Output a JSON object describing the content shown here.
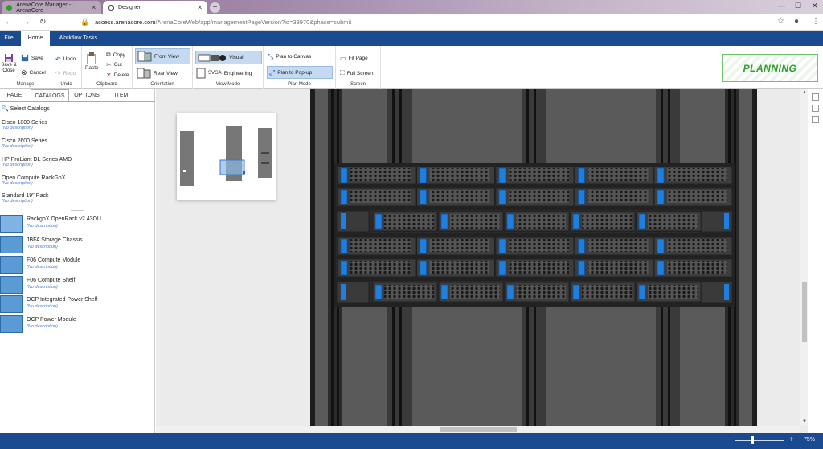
{
  "browser": {
    "tabs": [
      {
        "label": "ArenaCore Manager - ArenaCore",
        "active": false
      },
      {
        "label": "Designer",
        "active": true
      }
    ],
    "url_domain": "access.arenacore.com",
    "url_path": "/ArenaCoreWeb/app/managementPageVersion?id=33970&phase=submit"
  },
  "menu": {
    "items": [
      "File",
      "Home",
      "Workflow Tasks"
    ],
    "active": "Home"
  },
  "ribbon": {
    "manage": {
      "save_close": "Save &\nClose",
      "save": "Save",
      "cancel": "Cancel",
      "label": "Manage"
    },
    "undo": {
      "undo": "Undo",
      "redo": "Redo",
      "label": "Undo"
    },
    "clipboard": {
      "paste": "Paste",
      "copy": "Copy",
      "cut": "Cut",
      "delete": "Delete",
      "label": "Clipboard"
    },
    "orientation": {
      "front": "Front View",
      "rear": "Rear View",
      "label": "Orientation"
    },
    "viewmode": {
      "visual": "Visual",
      "engineering": "Engineering",
      "svga": "SVGA",
      "label": "View Mode"
    },
    "planmode": {
      "canvas": "Plan to Canvas",
      "popup": "Plan to Pop-up",
      "label": "Plan Mode"
    },
    "screen": {
      "fit": "Fit Page",
      "full": "Full Screen",
      "label": "Screen"
    },
    "status": "PLANNING"
  },
  "leftpanel": {
    "tabs": [
      "PAGE",
      "CATALOGS",
      "OPTIONS",
      "ITEM"
    ],
    "active_tab": "CATALOGS",
    "select_label": "Select Catalogs",
    "catalogs": [
      {
        "title": "Cisco 1800 Series",
        "desc": "(No description)"
      },
      {
        "title": "Cisco 2600 Series",
        "desc": "(No description)"
      },
      {
        "title": "HP ProLiant DL Series AMD",
        "desc": "(No description)"
      },
      {
        "title": "Open Compute RackGoX",
        "desc": "(No description)"
      },
      {
        "title": "Standard 19\" Rack",
        "desc": "(No description)"
      }
    ],
    "components": [
      {
        "title": "RackgoX OpenRack v2 43OU",
        "desc": "(No description)"
      },
      {
        "title": "JBFA Storage Chassis",
        "desc": "(No description)"
      },
      {
        "title": "F06 Compute Module",
        "desc": "(No description)"
      },
      {
        "title": "F06 Compute Shelf",
        "desc": "(No description)"
      },
      {
        "title": "OCP Integrated Power Shelf",
        "desc": "(No description)"
      },
      {
        "title": "OCP Power Module",
        "desc": "(No description)"
      }
    ]
  },
  "statusbar": {
    "zoom_minus": "−",
    "zoom_plus": "+",
    "zoom": "75%"
  },
  "colors": {
    "brand": "#1a4a8f",
    "accent": "#4a7bd6",
    "planning": "#2e9e2e",
    "led": "#1e7fe0"
  }
}
